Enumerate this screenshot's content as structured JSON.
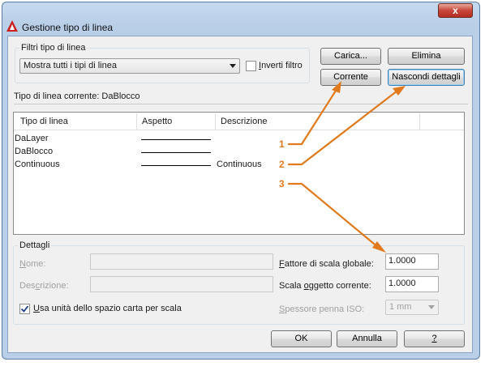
{
  "window": {
    "title": "Gestione tipo di linea",
    "close_glyph": "x"
  },
  "filters": {
    "legend": "Filtri tipo di linea",
    "selected": "Mostra tutti i tipi di linea",
    "invert_label": "Inverti filtro",
    "invert_checked": false
  },
  "buttons": {
    "load": "Carica...",
    "delete": "Elimina",
    "current": "Corrente",
    "hide_details": "Nascondi dettagli",
    "ok": "OK",
    "cancel": "Annulla",
    "help": "?"
  },
  "current_linetype": "Tipo di linea corrente:  DaBlocco",
  "list": {
    "columns": [
      "Tipo di linea",
      "Aspetto",
      "Descrizione"
    ],
    "rows": [
      {
        "name": "DaLayer",
        "description": ""
      },
      {
        "name": "DaBlocco",
        "description": ""
      },
      {
        "name": "Continuous",
        "description": "Continuous"
      }
    ]
  },
  "details": {
    "legend": "Dettagli",
    "name_label": "Nome:",
    "name_value": "",
    "description_label": "Descrizione:",
    "description_value": "",
    "paper_space_label": "Usa unità dello spazio carta per scala",
    "paper_space_checked": true,
    "global_scale_label": "Fattore di scala globale:",
    "global_scale_value": "1.0000",
    "object_scale_label": "Scala oggetto corrente:",
    "object_scale_value": "1.0000",
    "iso_pen_label": "Spessore penna ISO:",
    "iso_pen_value": "1 mm"
  },
  "callouts": [
    "1",
    "2",
    "3"
  ],
  "colors": {
    "callout": "#e07a1c",
    "title_bar": "#b9cfe8",
    "close_button": "#c7463a"
  },
  "icons": {
    "app": "autocad-icon",
    "close": "close-icon",
    "dropdown": "chevron-down-icon"
  }
}
